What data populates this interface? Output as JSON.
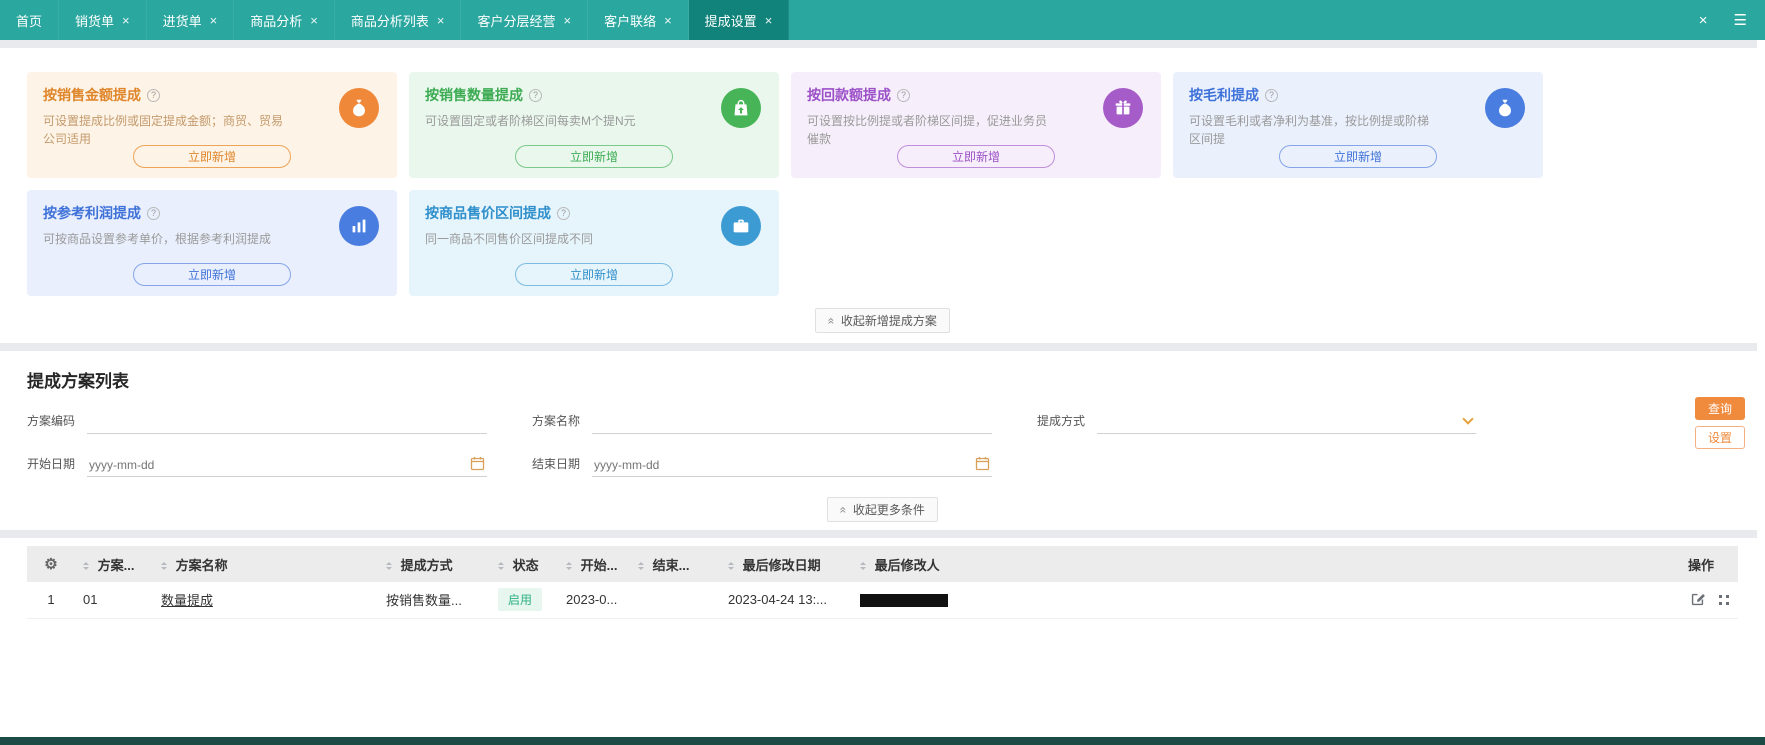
{
  "colors": {
    "topbar": "#2aa79f",
    "topbar_active": "#11837b",
    "primary_orange": "#f08a3c",
    "footer": "#1c4b45",
    "status_green": "#2eb180"
  },
  "topbar": {
    "tabs": [
      {
        "label": "首页",
        "closable": false,
        "active": false
      },
      {
        "label": "销货单",
        "closable": true,
        "active": false
      },
      {
        "label": "进货单",
        "closable": true,
        "active": false
      },
      {
        "label": "商品分析",
        "closable": true,
        "active": false
      },
      {
        "label": "商品分析列表",
        "closable": true,
        "active": false
      },
      {
        "label": "客户分层经营",
        "closable": true,
        "active": false
      },
      {
        "label": "客户联络",
        "closable": true,
        "active": false
      },
      {
        "label": "提成设置",
        "closable": true,
        "active": true
      }
    ],
    "close_glyph": "×",
    "menu_glyph": "☰"
  },
  "help_glyph": "?",
  "icons": {
    "collapse_chevrons": "«",
    "gear": "⚙"
  },
  "cards": [
    {
      "title": "按销售金额提成",
      "desc": "可设置提成比例或固定提成金额；商贸、贸易公司适用",
      "button": "立即新增",
      "accent": "#e0862a",
      "bg": "#fdf3e6",
      "icon": "money-bag-icon",
      "icon_bg": "#f0883a"
    },
    {
      "title": "按销售数量提成",
      "desc": "可设置固定或者阶梯区间每卖M个提N元",
      "button": "立即新增",
      "accent": "#3cab53",
      "bg": "#e9f7ec",
      "icon": "bag-arrow-icon",
      "icon_bg": "#47b457"
    },
    {
      "title": "按回款额提成",
      "desc": "可设置按比例提或者阶梯区间提，促进业务员催款",
      "button": "立即新增",
      "accent": "#9c50c8",
      "bg": "#f6eefa",
      "icon": "gift-icon",
      "icon_bg": "#a55cc9"
    },
    {
      "title": "按毛利提成",
      "desc": "可设置毛利或者净利为基准，按比例提或阶梯区间提",
      "button": "立即新增",
      "accent": "#3f72d9",
      "bg": "#eaf0fc",
      "icon": "money-bag-icon",
      "icon_bg": "#4a7de0"
    },
    {
      "title": "按参考利润提成",
      "desc": "可按商品设置参考单价，根据参考利润提成",
      "button": "立即新增",
      "accent": "#3f72d9",
      "bg": "#e9effc",
      "icon": "bar-chart-icon",
      "icon_bg": "#4a7de0"
    },
    {
      "title": "按商品售价区间提成",
      "desc": "同一商品不同售价区间提成不同",
      "button": "立即新增",
      "accent": "#2f8fcc",
      "bg": "#e6f4fb",
      "icon": "briefcase-icon",
      "icon_bg": "#3d9bd3"
    }
  ],
  "cards_collapse_label": "收起新增提成方案",
  "list": {
    "title": "提成方案列表",
    "filters": {
      "code_label": "方案编码",
      "name_label": "方案名称",
      "method_label": "提成方式",
      "start_label": "开始日期",
      "end_label": "结束日期",
      "date_placeholder": "yyyy-mm-dd",
      "query_button": "查询",
      "settings_button": "设置"
    },
    "more_collapse_label": "收起更多条件",
    "table": {
      "headers": [
        "方案...",
        "方案名称",
        "提成方式",
        "状态",
        "开始...",
        "结束...",
        "最后修改日期",
        "最后修改人",
        "操作"
      ],
      "rows": [
        {
          "index": "1",
          "code": "01",
          "name": "数量提成",
          "method": "按销售数量...",
          "status": "启用",
          "start": "2023-0...",
          "end": "",
          "modified_date": "2023-04-24 13:...",
          "modified_by_hidden": true
        }
      ]
    }
  }
}
